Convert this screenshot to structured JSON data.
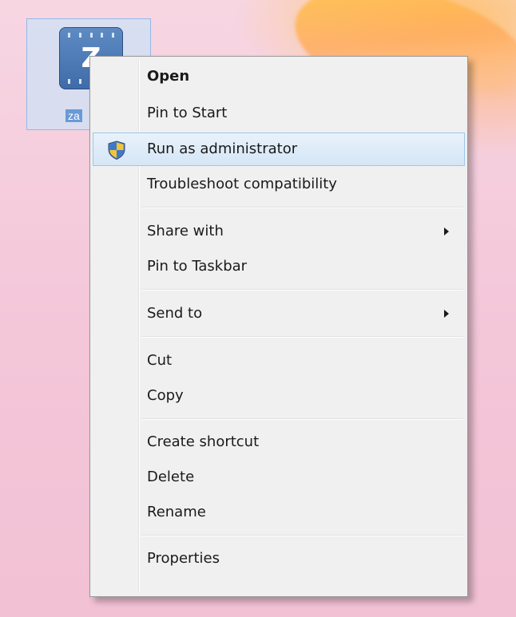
{
  "desktop": {
    "icon": {
      "icon_name": "file-sync-icon",
      "glyph": "Z",
      "caption": "za"
    }
  },
  "context_menu": {
    "items": [
      {
        "label": "Open",
        "default": true
      },
      {
        "label": "Pin to Start"
      },
      {
        "label": "Run as administrator",
        "icon": "uac-shield-icon",
        "highlighted": true
      },
      {
        "label": "Troubleshoot compatibility"
      },
      {
        "label": "Share with",
        "submenu": true
      },
      {
        "label": "Pin to Taskbar"
      },
      {
        "label": "Send to",
        "submenu": true
      },
      {
        "label": "Cut"
      },
      {
        "label": "Copy"
      },
      {
        "label": "Create shortcut"
      },
      {
        "label": "Delete"
      },
      {
        "label": "Rename"
      },
      {
        "label": "Properties"
      }
    ]
  },
  "colors": {
    "highlight_border": "#9fc5eb",
    "menu_background": "#f0f0f0",
    "icon_blue": "#3f6ba8"
  }
}
